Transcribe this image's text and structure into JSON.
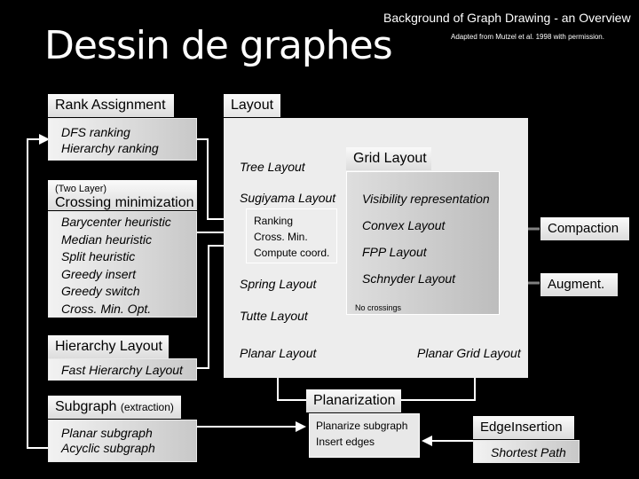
{
  "header": {
    "title": "Dessin de graphes",
    "subtitle": "Background of Graph Drawing - an Overview",
    "credit": "Adapted from Mutzel et al. 1998 with permission."
  },
  "rank_assignment": {
    "label": "Rank Assignment",
    "items": [
      "DFS ranking",
      "Hierarchy ranking"
    ]
  },
  "crossing_min": {
    "prefix": "(Two Layer)",
    "label": "Crossing minimization",
    "items": [
      "Barycenter heuristic",
      "Median heuristic",
      "Split heuristic",
      "Greedy insert",
      "Greedy switch",
      "Cross. Min. Opt."
    ]
  },
  "hierarchy_layout": {
    "label": "Hierarchy Layout",
    "items": [
      "Fast Hierarchy Layout"
    ]
  },
  "subgraph": {
    "label": "Subgraph",
    "suffix": "(extraction)",
    "items": [
      "Planar subgraph",
      "Acyclic subgraph"
    ]
  },
  "layout": {
    "label": "Layout",
    "items": {
      "tree": "Tree Layout",
      "sugiyama": "Sugiyama Layout",
      "sugiyama_steps": [
        "Ranking",
        "Cross.  Min.",
        "Compute coord."
      ],
      "spring": "Spring Layout",
      "tutte": "Tutte Layout",
      "planar": "Planar Layout",
      "planar_grid": "Planar Grid Layout"
    }
  },
  "grid_layout": {
    "label": "Grid Layout",
    "items": [
      "Visibility representation",
      "Convex Layout",
      "FPP Layout",
      "Schnyder Layout"
    ],
    "note": "No crossings"
  },
  "side_boxes": {
    "compaction": "Compaction",
    "augment": "Augment."
  },
  "planarization": {
    "label": "Planarization",
    "items": [
      "Planarize subgraph",
      "Insert edges"
    ]
  },
  "edge_insertion": {
    "label": "EdgeInsertion",
    "items": [
      "Shortest Path"
    ]
  }
}
